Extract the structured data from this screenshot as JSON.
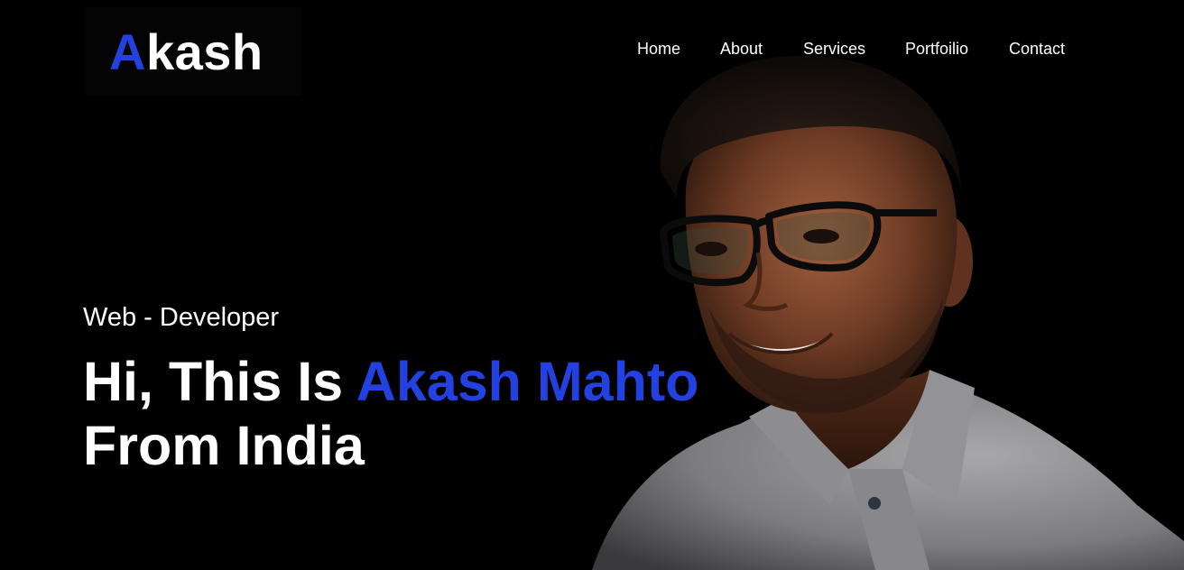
{
  "header": {
    "logo_first": "A",
    "logo_rest": "kash"
  },
  "nav": {
    "items": [
      {
        "label": "Home"
      },
      {
        "label": "About"
      },
      {
        "label": "Services"
      },
      {
        "label": "Portfoilio"
      },
      {
        "label": "Contact"
      }
    ]
  },
  "hero": {
    "subtitle": "Web - Developer",
    "headline_prefix": "Hi, This Is ",
    "headline_name": "Akash Mahto",
    "headline_suffix": "From India"
  },
  "colors": {
    "background": "#000000",
    "accent": "#2341e0",
    "text": "#ffffff"
  },
  "icons": {
    "portrait": "person-portrait"
  }
}
